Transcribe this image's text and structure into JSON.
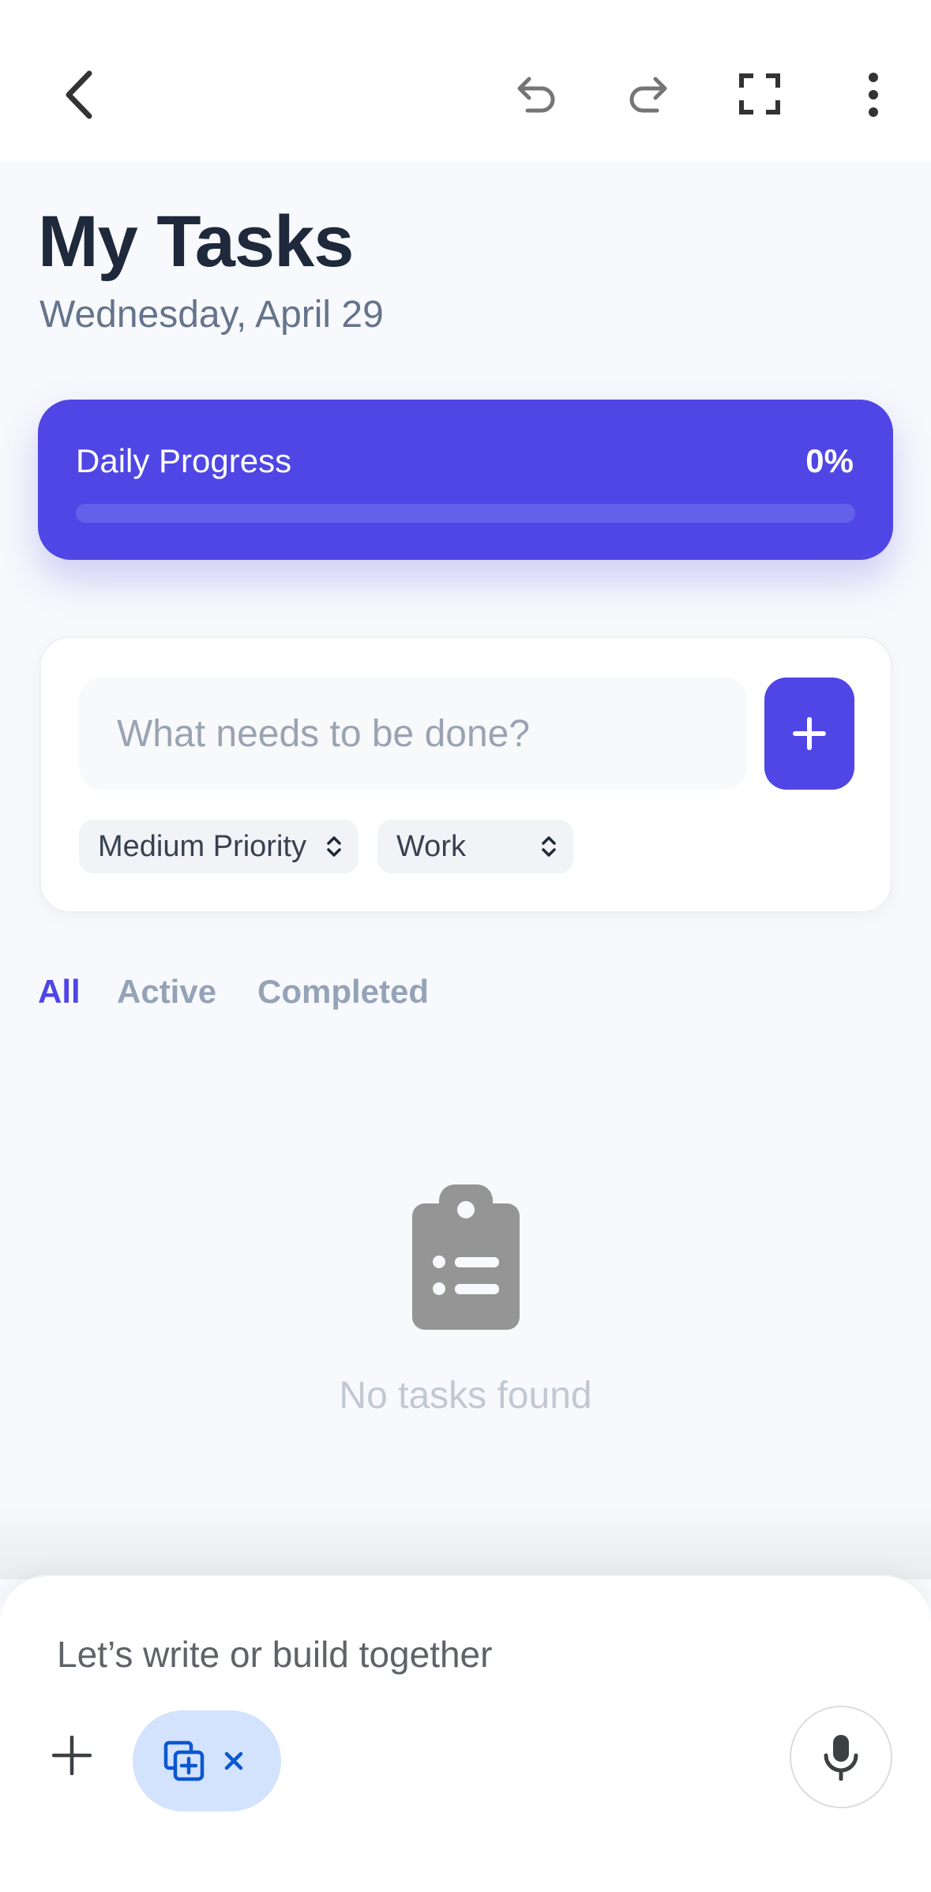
{
  "toolbar": {
    "back_icon": "chevron-left-icon",
    "undo_icon": "undo-icon",
    "redo_icon": "redo-icon",
    "fullscreen_icon": "fullscreen-icon",
    "more_icon": "more-vert-icon"
  },
  "header": {
    "title": "My Tasks",
    "date": "Wednesday, April 29"
  },
  "progress": {
    "label": "Daily Progress",
    "value_text": "0%",
    "fraction": 0
  },
  "add_task": {
    "placeholder": "What needs to be done?",
    "value": "",
    "add_icon": "plus-icon",
    "priority_selected": "Medium Priority",
    "category_selected": "Work"
  },
  "filters": {
    "tabs": [
      {
        "label": "All",
        "active": true
      },
      {
        "label": "Active",
        "active": false
      },
      {
        "label": "Completed",
        "active": false
      }
    ]
  },
  "empty_state": {
    "icon": "clipboard-list-icon",
    "text": "No tasks found"
  },
  "composer": {
    "placeholder": "Let’s write or build together",
    "add_icon": "plus-icon",
    "chip_icon": "canvas-add-icon",
    "chip_close_icon": "close-icon",
    "mic_icon": "mic-icon"
  },
  "colors": {
    "accent": "#4f46e5",
    "title": "#1e293b",
    "muted": "#64748b",
    "tab_inactive": "#94a3b8",
    "chip_bg": "#d3e3fd",
    "chip_fg": "#0b57d0"
  }
}
